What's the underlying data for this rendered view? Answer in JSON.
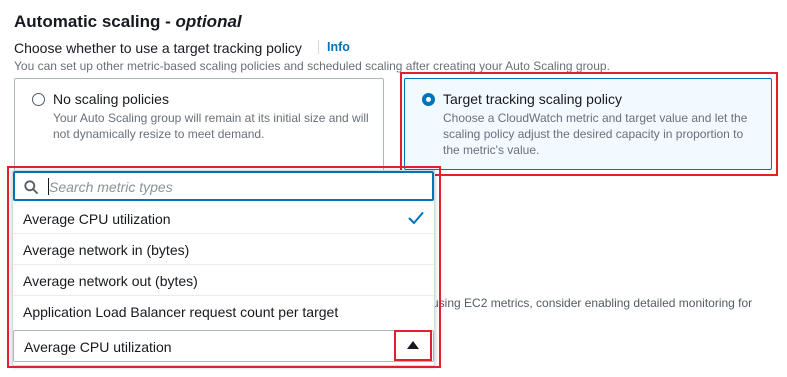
{
  "section": {
    "title": "Automatic scaling - ",
    "title_optional": "optional",
    "subtitle": "Choose whether to use a target tracking policy",
    "info_label": "Info",
    "description": "You can set up other metric-based scaling policies and scheduled scaling after creating your Auto Scaling group."
  },
  "tiles": [
    {
      "title": "No scaling policies",
      "description": "Your Auto Scaling group will remain at its initial size and will not dynamically resize to meet demand.",
      "selected": false
    },
    {
      "title": "Target tracking scaling policy",
      "description": "Choose a CloudWatch metric and target value and let the scaling policy adjust the desired capacity in proportion to the metric's value.",
      "selected": true
    }
  ],
  "dropdown": {
    "search_placeholder": "Search metric types",
    "options": [
      {
        "label": "Average CPU utilization",
        "selected": true
      },
      {
        "label": "Average network in (bytes)",
        "selected": false
      },
      {
        "label": "Average network out (bytes)",
        "selected": false
      },
      {
        "label": "Application Load Balancer request count per target",
        "selected": false
      }
    ],
    "selected_value": "Average CPU utilization"
  },
  "background_text": "using EC2 metrics, consider enabling detailed monitoring for",
  "colors": {
    "accent": "#0073bb",
    "highlight": "#e0202a",
    "text": "#16191f",
    "muted": "#687078"
  },
  "icons": {
    "search": "search-icon",
    "check": "check-icon",
    "caret": "caret-up-icon"
  }
}
